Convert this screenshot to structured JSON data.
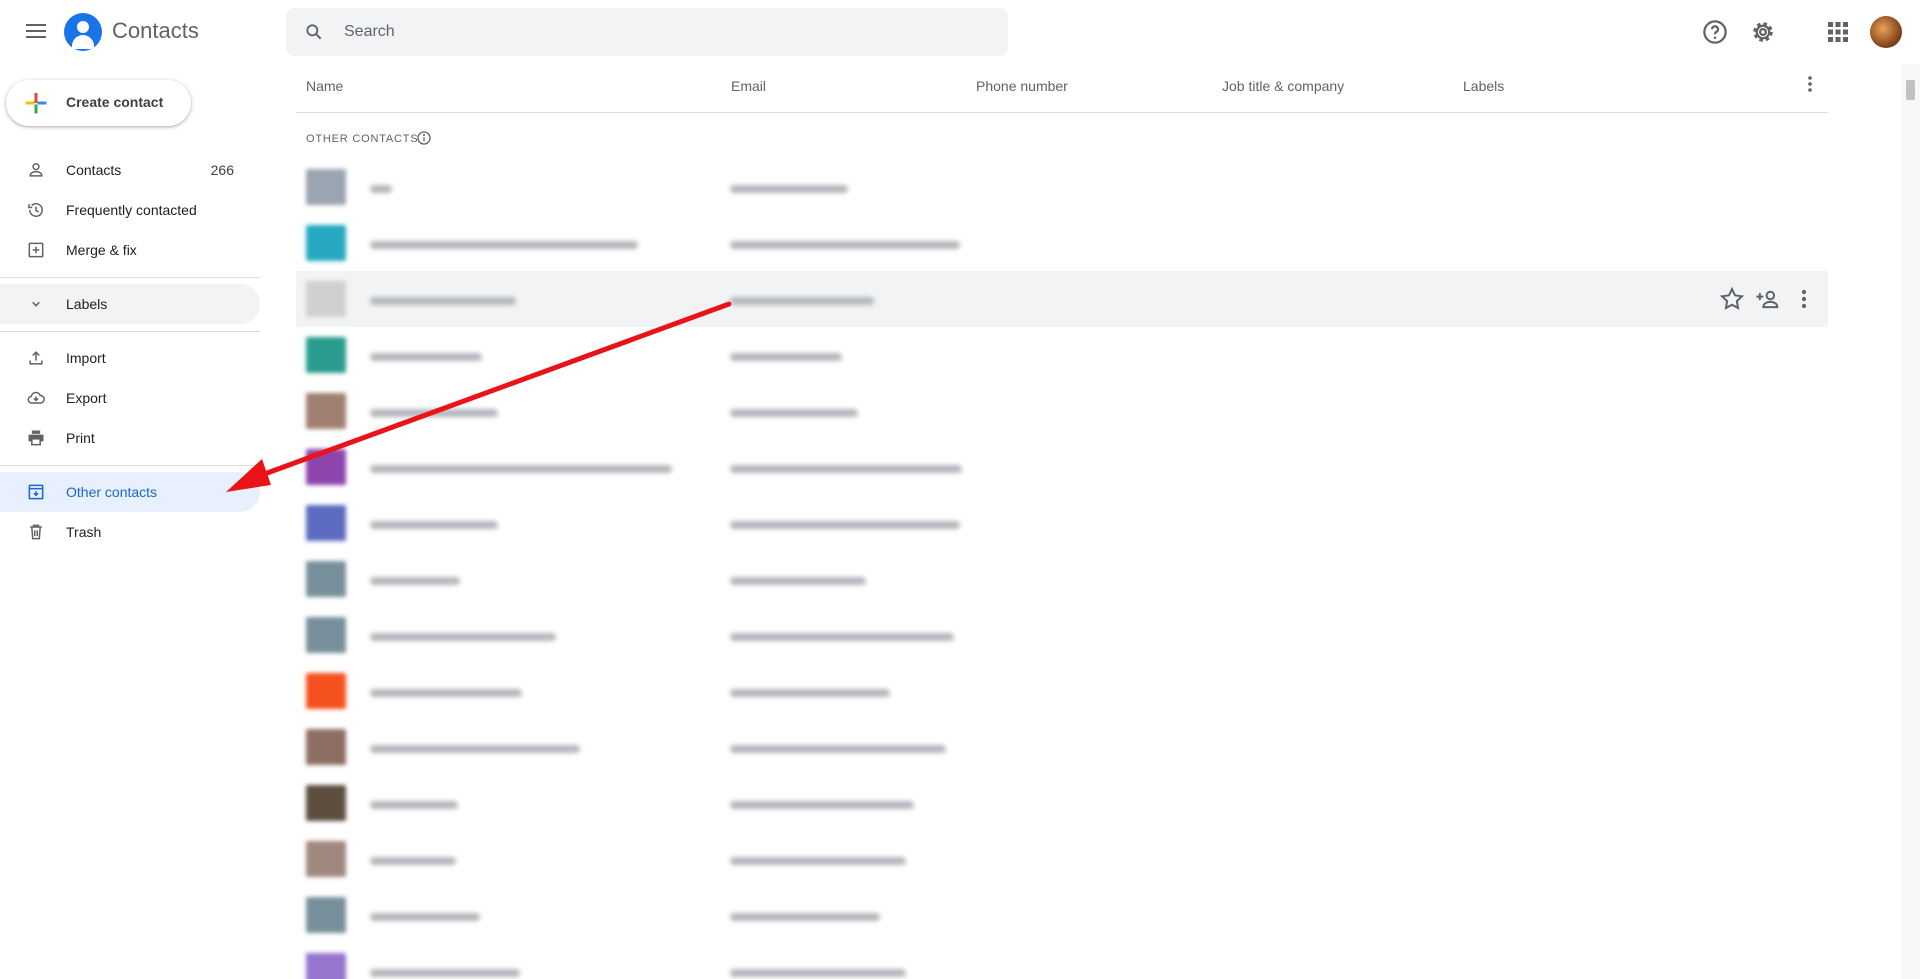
{
  "header": {
    "menu_icon": "menu-icon",
    "app_title": "Contacts",
    "search_placeholder": "Search",
    "icons": [
      "help-icon",
      "settings-icon",
      "apps-icon",
      "account-avatar"
    ]
  },
  "sidebar": {
    "create_label": "Create contact",
    "items": [
      {
        "label": "Contacts",
        "count": "266",
        "icon": "person-icon"
      },
      {
        "label": "Frequently contacted",
        "icon": "history-icon"
      },
      {
        "label": "Merge & fix",
        "icon": "merge-icon"
      },
      {
        "label": "Labels",
        "icon": "chevron-down-icon"
      },
      {
        "label": "Import",
        "icon": "upload-icon"
      },
      {
        "label": "Export",
        "icon": "cloud-download-icon"
      },
      {
        "label": "Print",
        "icon": "print-icon"
      },
      {
        "label": "Other contacts",
        "icon": "archive-icon",
        "active": true
      },
      {
        "label": "Trash",
        "icon": "trash-icon"
      }
    ]
  },
  "main": {
    "columns": [
      "Name",
      "Email",
      "Phone number",
      "Job title & company",
      "Labels"
    ],
    "section_label": "OTHER CONTACTS",
    "row_actions": [
      "star-icon",
      "add-contact-icon",
      "more-vert-icon"
    ],
    "rows": [
      {
        "avatar_color": "#9aa5b1"
      },
      {
        "avatar_color": "#26a9c0"
      },
      {
        "avatar_color": "#d0d0d0"
      },
      {
        "avatar_color": "#2a9d8f"
      },
      {
        "avatar_color": "#a08070"
      },
      {
        "avatar_color": "#8e44ad"
      },
      {
        "avatar_color": "#5c6bc0"
      },
      {
        "avatar_color": "#78909c"
      },
      {
        "avatar_color": "#78909c"
      },
      {
        "avatar_color": "#f4511e"
      },
      {
        "avatar_color": "#8d6e63"
      },
      {
        "avatar_color": "#5d4e3f"
      },
      {
        "avatar_color": "#a1887f"
      },
      {
        "avatar_color": "#78909c"
      },
      {
        "avatar_color": "#9575cd"
      }
    ]
  },
  "colors": {
    "accent": "#1a73e8",
    "active_bg": "#e8f0fe",
    "annotation_arrow": "#e8141a"
  }
}
